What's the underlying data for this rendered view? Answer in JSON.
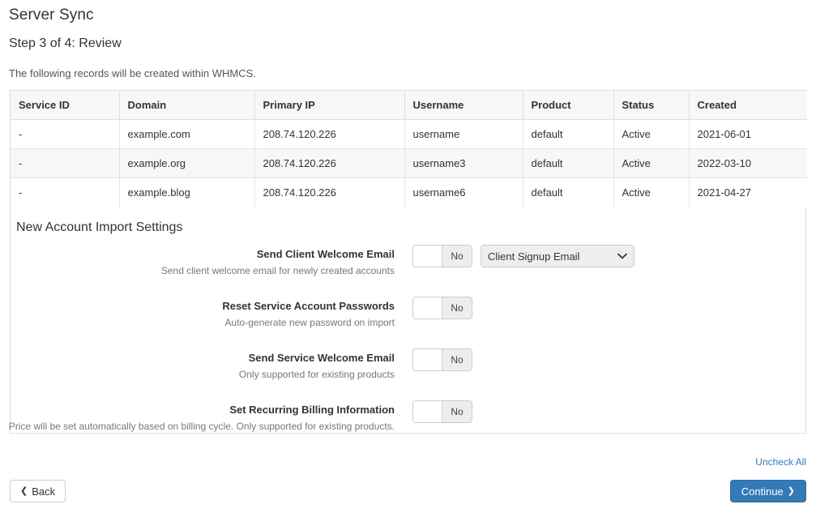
{
  "header": {
    "title": "Server Sync",
    "step_title": "Step 3 of 4: Review",
    "intro": "The following records will be created within WHMCS."
  },
  "table": {
    "columns": [
      "Service ID",
      "Domain",
      "Primary IP",
      "Username",
      "Product",
      "Status",
      "Created"
    ],
    "rows": [
      [
        "-",
        "example.com",
        "208.74.120.226",
        "username",
        "default",
        "Active",
        "2021-06-01"
      ],
      [
        "-",
        "example.org",
        "208.74.120.226",
        "username3",
        "default",
        "Active",
        "2022-03-10"
      ],
      [
        "-",
        "example.blog",
        "208.74.120.226",
        "username6",
        "default",
        "Active",
        "2021-04-27"
      ]
    ]
  },
  "settings": {
    "title": "New Account Import Settings",
    "rows": [
      {
        "label": "Send Client Welcome Email",
        "help": "Send client welcome email for newly created accounts",
        "toggle_state": "No",
        "select": {
          "value": "Client Signup Email",
          "options": [
            "Client Signup Email"
          ]
        }
      },
      {
        "label": "Reset Service Account Passwords",
        "help": "Auto-generate new password on import",
        "toggle_state": "No"
      },
      {
        "label": "Send Service Welcome Email",
        "help": "Only supported for existing products",
        "toggle_state": "No"
      },
      {
        "label": "Set Recurring Billing Information",
        "help": "Price will be set automatically based on billing cycle. Only supported for existing products.",
        "toggle_state": "No"
      }
    ]
  },
  "footer": {
    "uncheck_all": "Uncheck All",
    "back_label": "Back",
    "continue_label": "Continue"
  },
  "colors": {
    "primary": "#337ab7",
    "link": "#337ab7",
    "border": "#dddddd",
    "stripe": "#f7f7f7"
  }
}
